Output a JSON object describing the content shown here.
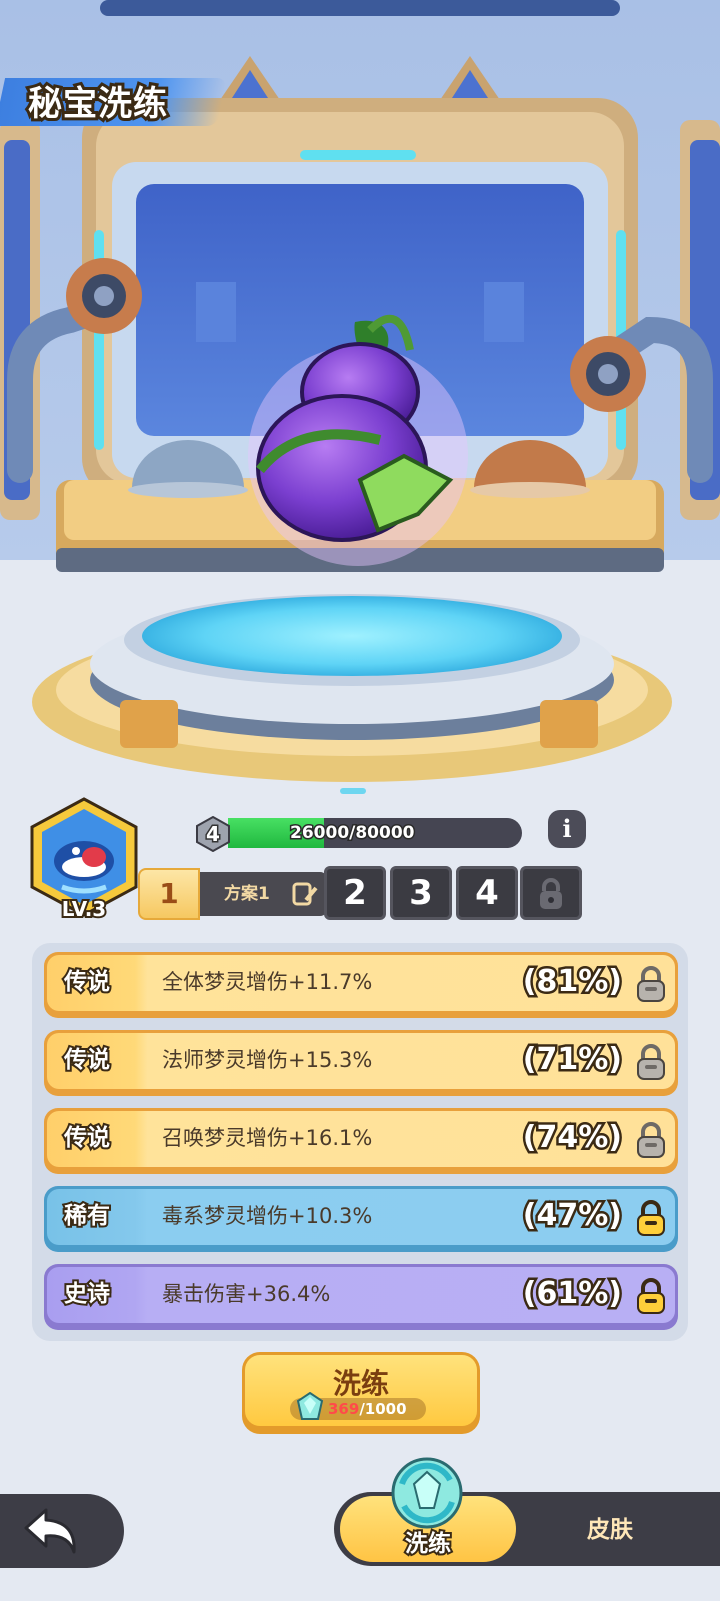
{
  "header": {
    "title": "秘宝洗练"
  },
  "treasure": {
    "name_icon": "purple-gourd-icon"
  },
  "level": {
    "label": "LV.3",
    "avatar_icon": "whale-avatar-icon"
  },
  "progress": {
    "rank": "4",
    "current": 26000,
    "max": 80000,
    "text": "26000/80000",
    "fraction": 0.325
  },
  "schemes": {
    "active_number": "1",
    "active_label": "方案1",
    "tabs": [
      "2",
      "3",
      "4"
    ]
  },
  "attributes": [
    {
      "tier": "传说",
      "text": "全体梦灵增伤+11.7%",
      "pct": "(81%)",
      "style": "gold",
      "locked": true
    },
    {
      "tier": "传说",
      "text": "法师梦灵增伤+15.3%",
      "pct": "(71%)",
      "style": "gold",
      "locked": true
    },
    {
      "tier": "传说",
      "text": "召唤梦灵增伤+16.1%",
      "pct": "(74%)",
      "style": "gold",
      "locked": true
    },
    {
      "tier": "稀有",
      "text": "毒系梦灵增伤+10.3%",
      "pct": "(47%)",
      "style": "blue",
      "locked": false
    },
    {
      "tier": "史诗",
      "text": "暴击伤害+36.4%",
      "pct": "(61%)",
      "style": "purple",
      "locked": false
    }
  ],
  "refine_button": {
    "label": "洗练",
    "cost_current": "369",
    "cost_total": "/1000"
  },
  "bottom_tabs": {
    "refine": "洗练",
    "skin": "皮肤"
  },
  "colors": {
    "gold": "#ffd978",
    "blue": "#8bcdf0",
    "purple": "#b7aef4",
    "xp_fill": "#2fcf4f"
  }
}
